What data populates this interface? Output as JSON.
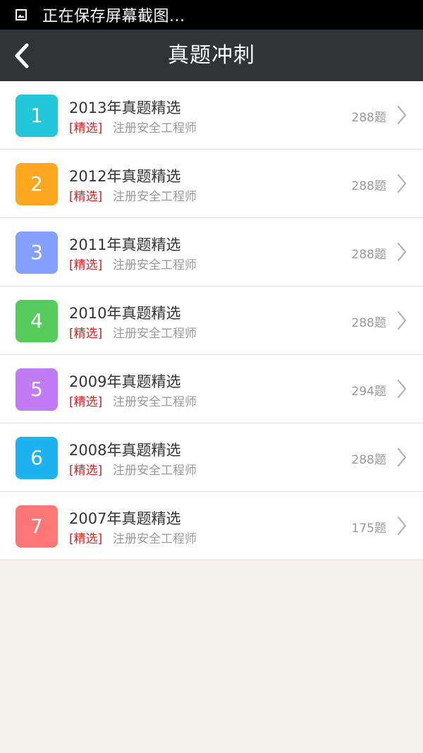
{
  "status_bar": {
    "icon": "image-icon",
    "text": "正在保存屏幕截图..."
  },
  "header": {
    "back_icon": "chevron-left-icon",
    "title": "真题冲刺"
  },
  "list": {
    "items": [
      {
        "number": "1",
        "color": "#22c7d9",
        "title": "2013年真题精选",
        "tag": "[精选]",
        "subtitle": "注册安全工程师",
        "count": "288题"
      },
      {
        "number": "2",
        "color": "#ffa81f",
        "title": "2012年真题精选",
        "tag": "[精选]",
        "subtitle": "注册安全工程师",
        "count": "288题"
      },
      {
        "number": "3",
        "color": "#86a0ff",
        "title": "2011年真题精选",
        "tag": "[精选]",
        "subtitle": "注册安全工程师",
        "count": "288题"
      },
      {
        "number": "4",
        "color": "#55cc5c",
        "title": "2010年真题精选",
        "tag": "[精选]",
        "subtitle": "注册安全工程师",
        "count": "288题"
      },
      {
        "number": "5",
        "color": "#c07bf5",
        "title": "2009年真题精选",
        "tag": "[精选]",
        "subtitle": "注册安全工程师",
        "count": "294题"
      },
      {
        "number": "6",
        "color": "#1eb2ee",
        "title": "2008年真题精选",
        "tag": "[精选]",
        "subtitle": "注册安全工程师",
        "count": "288题"
      },
      {
        "number": "7",
        "color": "#ff7676",
        "title": "2007年真题精选",
        "tag": "[精选]",
        "subtitle": "注册安全工程师",
        "count": "175题"
      }
    ],
    "chevron_icon": "chevron-right-icon"
  },
  "colors": {
    "status_bar_bg": "#000000",
    "header_bg": "#303436",
    "page_bg": "#f5f2ea",
    "tag_red": "#e02020",
    "secondary_gray": "#9a9a9a"
  }
}
